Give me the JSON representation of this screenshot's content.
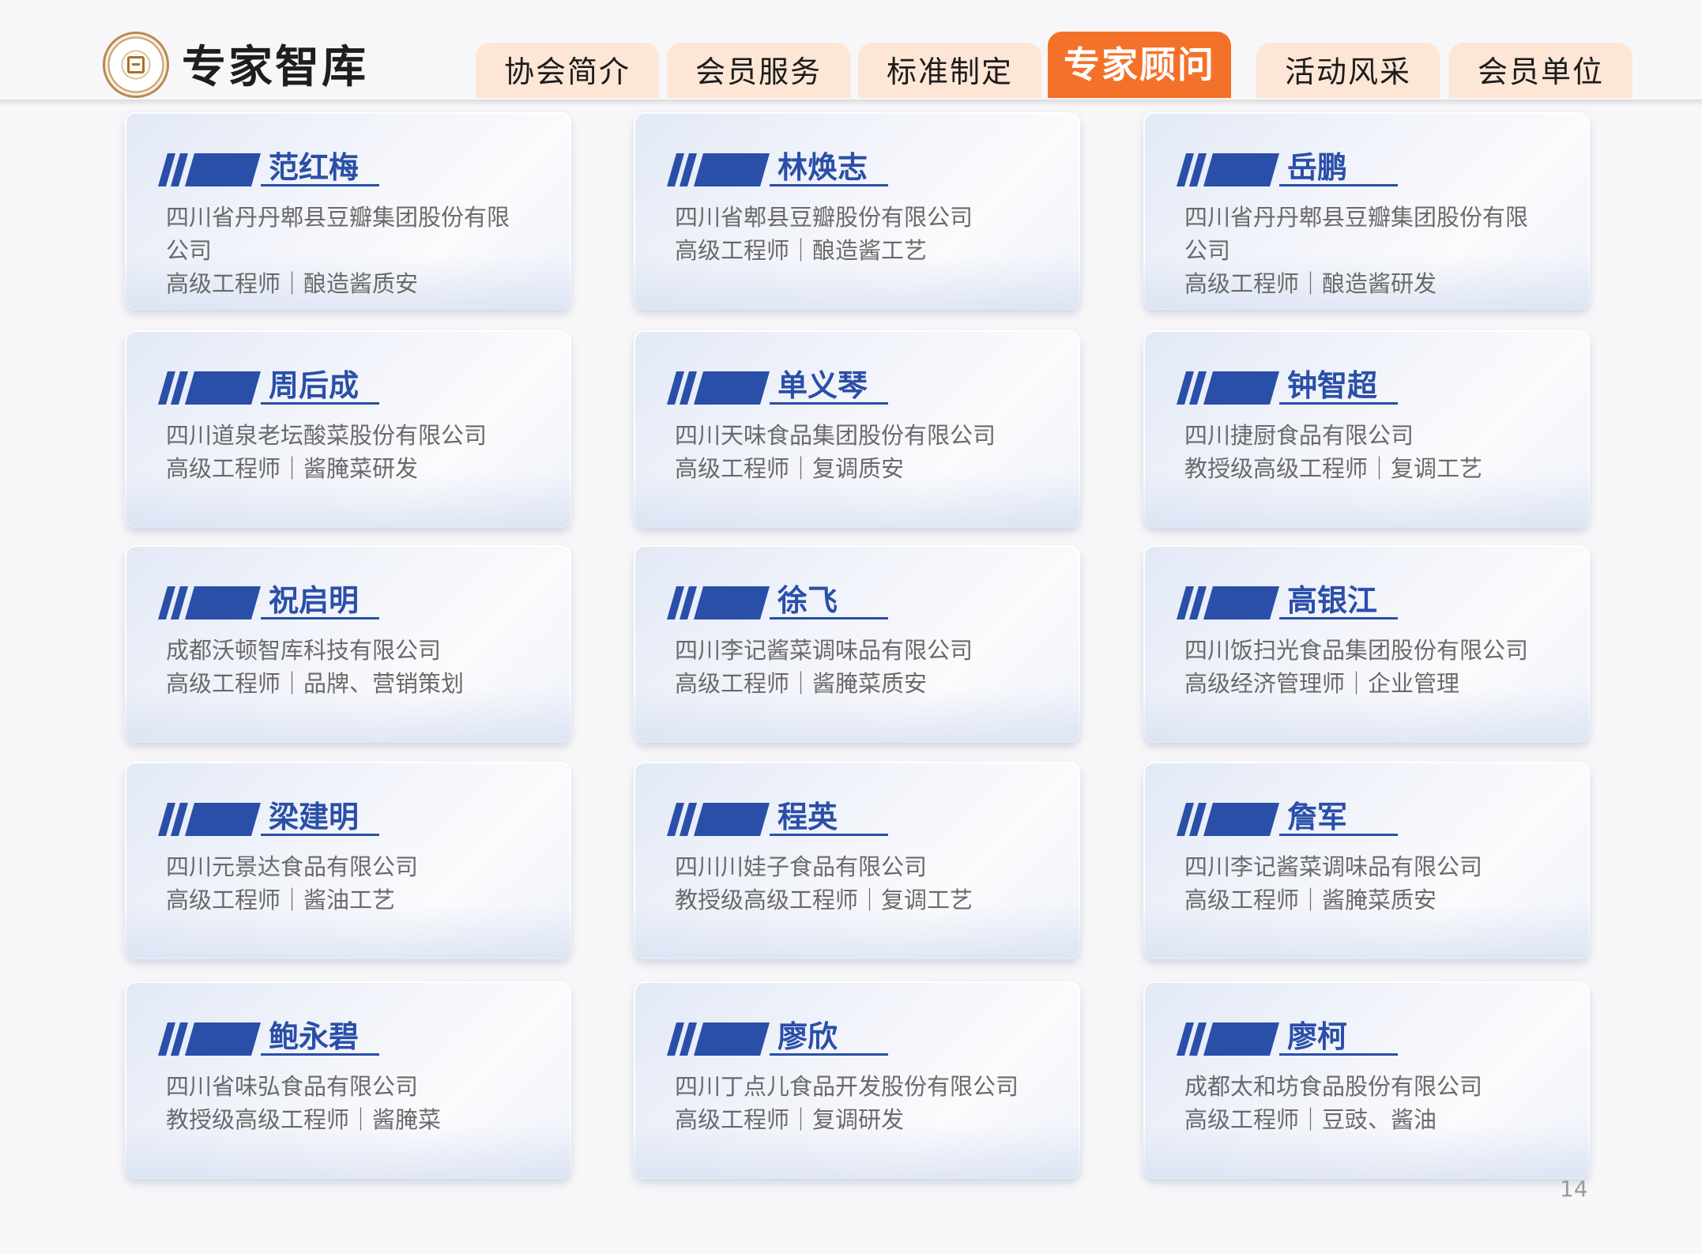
{
  "header": {
    "title": "专家智库",
    "logo_icon": "association-seal-logo"
  },
  "nav": {
    "tabs": [
      {
        "label": "协会简介"
      },
      {
        "label": "会员服务"
      },
      {
        "label": "标准制定"
      },
      {
        "label": "专家顾问",
        "active": true
      },
      {
        "label": "活动风采"
      },
      {
        "label": "会员单位"
      }
    ]
  },
  "colors": {
    "accent_orange": "#f4712a",
    "tab_inactive": "#fde6d6",
    "name_blue": "#2a4fa8"
  },
  "experts": [
    {
      "name": "范红梅",
      "org": "四川省丹丹郫县豆瓣集团股份有限公司",
      "role": "高级工程师｜酿造酱质安"
    },
    {
      "name": "林焕志",
      "org": "四川省郫县豆瓣股份有限公司",
      "role": "高级工程师｜酿造酱工艺"
    },
    {
      "name": "岳鹏",
      "org": "四川省丹丹郫县豆瓣集团股份有限公司",
      "role": "高级工程师｜酿造酱研发"
    },
    {
      "name": "周后成",
      "org": "四川道泉老坛酸菜股份有限公司",
      "role": "高级工程师｜酱腌菜研发"
    },
    {
      "name": "单义琴",
      "org": "四川天味食品集团股份有限公司",
      "role": "高级工程师｜复调质安"
    },
    {
      "name": "钟智超",
      "org": "四川捷厨食品有限公司",
      "role": "教授级高级工程师｜复调工艺"
    },
    {
      "name": "祝启明",
      "org": "成都沃顿智库科技有限公司",
      "role": "高级工程师｜品牌、营销策划"
    },
    {
      "name": "徐飞",
      "org": "四川李记酱菜调味品有限公司",
      "role": "高级工程师｜酱腌菜质安"
    },
    {
      "name": "高银江",
      "org": "四川饭扫光食品集团股份有限公司",
      "role": "高级经济管理师｜企业管理"
    },
    {
      "name": "梁建明",
      "org": "四川元景达食品有限公司",
      "role": "高级工程师｜酱油工艺"
    },
    {
      "name": "程英",
      "org": "四川川娃子食品有限公司",
      "role": "教授级高级工程师｜复调工艺"
    },
    {
      "name": "詹军",
      "org": "四川李记酱菜调味品有限公司",
      "role": "高级工程师｜酱腌菜质安"
    },
    {
      "name": "鲍永碧",
      "org": "四川省味弘食品有限公司",
      "role": "教授级高级工程师｜酱腌菜"
    },
    {
      "name": "廖欣",
      "org": "四川丁点儿食品开发股份有限公司",
      "role": "高级工程师｜复调研发"
    },
    {
      "name": "廖柯",
      "org": "成都太和坊食品股份有限公司",
      "role": "高级工程师｜豆豉、酱油"
    }
  ],
  "page_number": "14"
}
